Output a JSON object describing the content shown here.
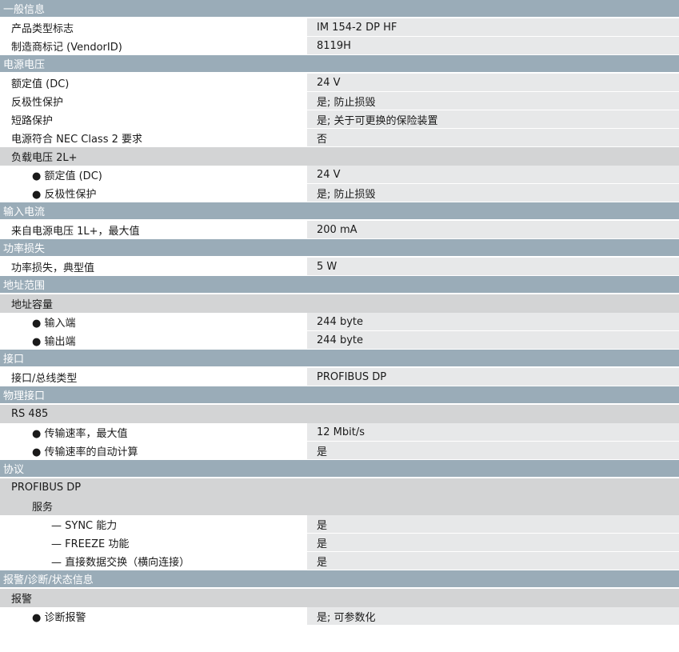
{
  "rows": [
    {
      "kind": "section",
      "label": "一般信息"
    },
    {
      "kind": "data",
      "indent": 0,
      "label": "产品类型标志",
      "value": "IM 154-2 DP HF"
    },
    {
      "kind": "data",
      "indent": 0,
      "label": "制造商标记 (VendorID)",
      "value": "8119H"
    },
    {
      "kind": "section",
      "label": "电源电压"
    },
    {
      "kind": "data",
      "indent": 0,
      "label": "额定值 (DC)",
      "value": "24 V"
    },
    {
      "kind": "data",
      "indent": 0,
      "label": "反极性保护",
      "value": "是; 防止损毁"
    },
    {
      "kind": "data",
      "indent": 0,
      "label": "短路保护",
      "value": "是; 关于可更换的保险装置"
    },
    {
      "kind": "data",
      "indent": 0,
      "label": "电源符合 NEC Class 2 要求",
      "value": "否"
    },
    {
      "kind": "sub",
      "indent": 0,
      "label": "负载电压 2L+"
    },
    {
      "kind": "data",
      "indent": 1,
      "label": "● 额定值 (DC)",
      "value": "24 V"
    },
    {
      "kind": "data",
      "indent": 1,
      "label": "● 反极性保护",
      "value": "是; 防止损毁"
    },
    {
      "kind": "section",
      "label": "输入电流"
    },
    {
      "kind": "data",
      "indent": 0,
      "label": "来自电源电压 1L+，最大值",
      "value": "200 mA"
    },
    {
      "kind": "section",
      "label": "功率损失"
    },
    {
      "kind": "data",
      "indent": 0,
      "label": "功率损失，典型值",
      "value": "5 W"
    },
    {
      "kind": "section",
      "label": "地址范围"
    },
    {
      "kind": "sub",
      "indent": 0,
      "label": "地址容量"
    },
    {
      "kind": "data",
      "indent": 1,
      "label": "● 输入端",
      "value": "244 byte"
    },
    {
      "kind": "data",
      "indent": 1,
      "label": "● 输出端",
      "value": "244 byte"
    },
    {
      "kind": "section",
      "label": "接口"
    },
    {
      "kind": "data",
      "indent": 0,
      "label": "接口/总线类型",
      "value": "PROFIBUS DP"
    },
    {
      "kind": "section",
      "label": "物理接口"
    },
    {
      "kind": "sub",
      "indent": 0,
      "label": "RS 485"
    },
    {
      "kind": "data",
      "indent": 1,
      "label": "● 传输速率，最大值",
      "value": "12 Mbit/s"
    },
    {
      "kind": "data",
      "indent": 1,
      "label": "● 传输速率的自动计算",
      "value": "是"
    },
    {
      "kind": "section",
      "label": "协议"
    },
    {
      "kind": "sub",
      "indent": 0,
      "label": "PROFIBUS DP"
    },
    {
      "kind": "sub",
      "indent": 1,
      "label": "服务"
    },
    {
      "kind": "data",
      "indent": 2,
      "label": "— SYNC 能力",
      "value": "是"
    },
    {
      "kind": "data",
      "indent": 2,
      "label": "— FREEZE 功能",
      "value": "是"
    },
    {
      "kind": "data",
      "indent": 2,
      "label": "— 直接数据交换（横向连接）",
      "value": "是"
    },
    {
      "kind": "section",
      "label": "报警/诊断/状态信息"
    },
    {
      "kind": "sub",
      "indent": 0,
      "label": "报警"
    },
    {
      "kind": "data",
      "indent": 1,
      "label": "● 诊断报警",
      "value": "是; 可参数化"
    }
  ]
}
